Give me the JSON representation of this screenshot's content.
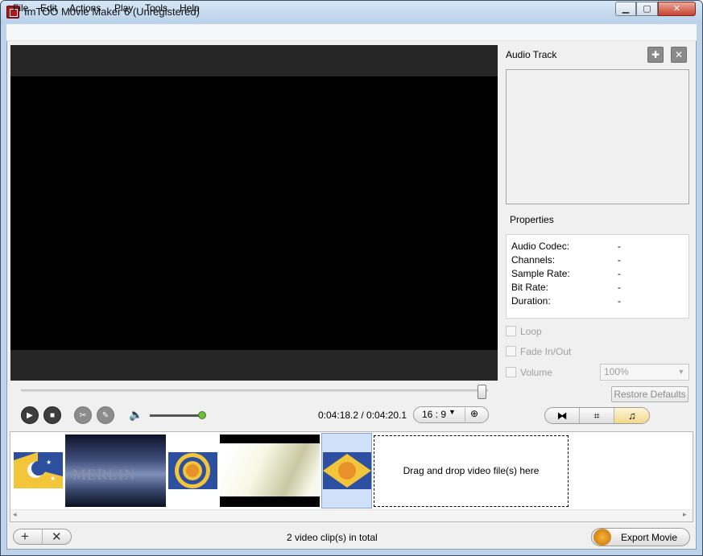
{
  "window": {
    "title": "ImTOO Movie Maker 6 (Unregistered)",
    "minimize": "▁",
    "maximize": "▢",
    "close": "✕"
  },
  "menu": [
    "File",
    "Edit",
    "Actions",
    "Play",
    "Tools",
    "Help"
  ],
  "audio_panel": {
    "title": "Audio Track",
    "add_icon": "✚",
    "close_icon": "✕",
    "properties_title": "Properties",
    "properties": [
      {
        "label": "Audio Codec:",
        "value": "-"
      },
      {
        "label": "Channels:",
        "value": "-"
      },
      {
        "label": "Sample Rate:",
        "value": "-"
      },
      {
        "label": "Bit Rate:",
        "value": "-"
      },
      {
        "label": "Duration:",
        "value": "-"
      }
    ],
    "loop_label": "Loop",
    "fade_label": "Fade In/Out",
    "volume_label": "Volume",
    "volume_value": "100%",
    "restore_label": "Restore Defaults"
  },
  "player": {
    "time": "0:04:18.2 / 0:04:20.1",
    "aspect": "16 : 9",
    "seek_position": 0.99,
    "volume_level": 1.0
  },
  "timeline": {
    "clip2_text": "MERLIN",
    "drop_text": "Drag and drop video file(s) here"
  },
  "bottom": {
    "status": "2 video clip(s) in total",
    "export_label": "Export Movie",
    "add_icon": "+",
    "remove_icon": "✕"
  },
  "icons": {
    "play": "▶",
    "stop": "■",
    "cut": "✂",
    "edit": "✎",
    "volume": "🔈",
    "fit": "⊕",
    "dropdown": "▼",
    "view_split": "⧓",
    "view_crop": "⌗",
    "view_music": "♫",
    "scroll_left": "◂",
    "scroll_right": "▸"
  }
}
